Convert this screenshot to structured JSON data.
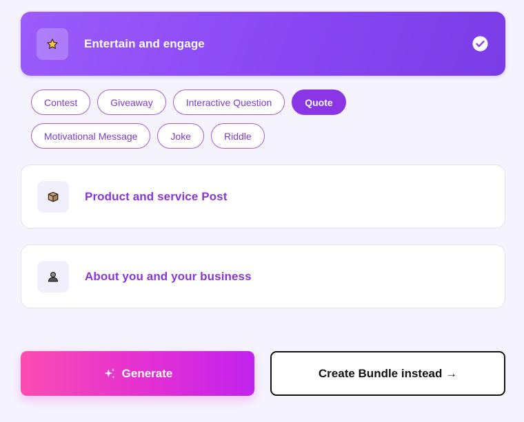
{
  "categories": [
    {
      "title": "Entertain and engage",
      "icon": "star-icon",
      "selected": true,
      "options": [
        {
          "label": "Contest",
          "active": false
        },
        {
          "label": "Giveaway",
          "active": false
        },
        {
          "label": "Interactive Question",
          "active": false
        },
        {
          "label": "Quote",
          "active": true
        },
        {
          "label": "Motivational Message",
          "active": false
        },
        {
          "label": "Joke",
          "active": false
        },
        {
          "label": "Riddle",
          "active": false
        }
      ]
    },
    {
      "title": "Product and service Post",
      "icon": "package-icon",
      "selected": false
    },
    {
      "title": "About you and your business",
      "icon": "person-icon",
      "selected": false
    }
  ],
  "actions": {
    "generate_label": "Generate",
    "bundle_label": "Create Bundle instead →"
  },
  "colors": {
    "accent": "#8a35e6",
    "generate_gradient_start": "#fb4db1",
    "generate_gradient_end": "#c223ee"
  }
}
